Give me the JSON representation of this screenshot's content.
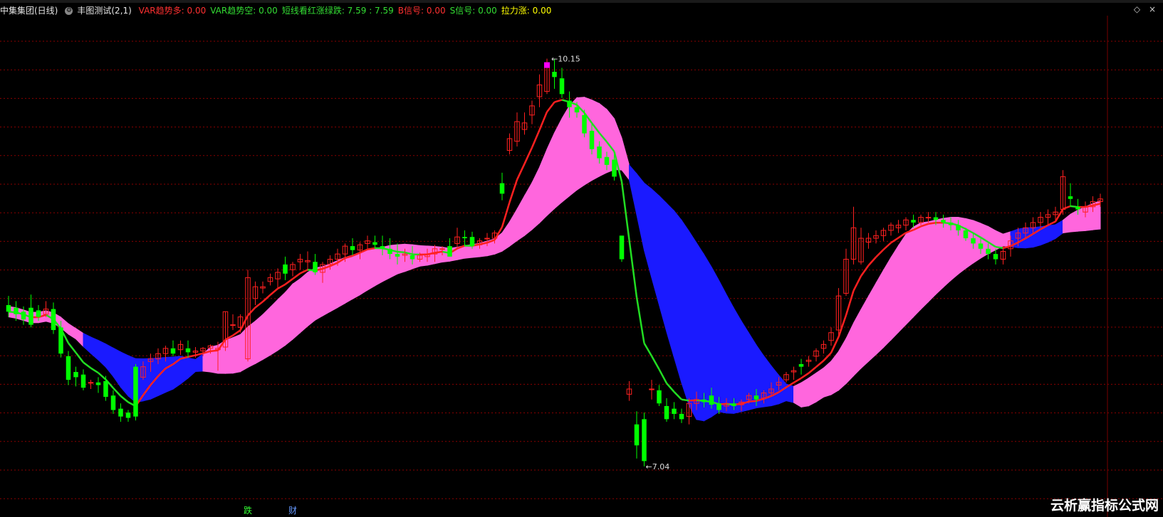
{
  "header": {
    "stock": "中集集团(日线)",
    "indicator": "丰图测试(2,1)",
    "items": [
      {
        "text": "VAR趋势多: 0.00",
        "color": "red"
      },
      {
        "text": "VAR趋势空: 0.00",
        "color": "green"
      },
      {
        "text": "短线看红涨绿跌: 7.59 : 7.59",
        "color": "green"
      },
      {
        "text": "B信号: 0.00",
        "color": "red"
      },
      {
        "text": "S信号: 0.00",
        "color": "green"
      },
      {
        "text": "拉力涨: 0.00",
        "color": "yellow"
      }
    ]
  },
  "window_controls": {
    "diamond": "◇",
    "close": "×"
  },
  "watermark": "云析赢指标公式网",
  "bottom_labels": [
    {
      "text": "跌",
      "index": 32,
      "color": "#33ff33"
    },
    {
      "text": "财",
      "index": 38,
      "color": "#6699ff"
    }
  ],
  "colors": {
    "up": "#ff2020",
    "down": "#00ff00",
    "grid": "#8b0000",
    "trend_up": "#ff2020",
    "trend_down": "#22dd22",
    "band_bull": "#ff66dd",
    "band_bear": "#1a1aff",
    "magenta": "#ff00ff",
    "label_green": "#33ff33",
    "label_red": "#ff3030"
  },
  "chart_data": {
    "type": "candlestick",
    "ylim": [
      6.8,
      10.5
    ],
    "max_label": "10.15",
    "min_label": "7.04",
    "ohlc": [
      [
        8.27,
        8.34,
        8.18,
        8.22
      ],
      [
        8.25,
        8.3,
        8.15,
        8.2
      ],
      [
        8.22,
        8.26,
        8.12,
        8.16
      ],
      [
        8.25,
        8.35,
        8.1,
        8.12
      ],
      [
        8.23,
        8.27,
        8.15,
        8.18
      ],
      [
        8.2,
        8.3,
        8.18,
        8.24
      ],
      [
        8.24,
        8.29,
        8.05,
        8.08
      ],
      [
        8.1,
        8.15,
        7.87,
        7.9
      ],
      [
        7.88,
        7.92,
        7.66,
        7.7
      ],
      [
        7.76,
        7.8,
        7.65,
        7.72
      ],
      [
        7.74,
        7.78,
        7.62,
        7.64
      ],
      [
        7.68,
        7.7,
        7.63,
        7.68
      ],
      [
        7.68,
        7.72,
        7.6,
        7.66
      ],
      [
        7.69,
        7.73,
        7.54,
        7.57
      ],
      [
        7.58,
        7.62,
        7.44,
        7.47
      ],
      [
        7.48,
        7.52,
        7.38,
        7.42
      ],
      [
        7.45,
        7.47,
        7.38,
        7.41
      ],
      [
        7.8,
        7.82,
        7.39,
        7.42
      ],
      [
        7.72,
        7.84,
        7.7,
        7.8
      ],
      [
        7.84,
        7.9,
        7.76,
        7.86
      ],
      [
        7.86,
        7.94,
        7.82,
        7.9
      ],
      [
        7.9,
        7.96,
        7.84,
        7.94
      ],
      [
        7.94,
        8.0,
        7.88,
        7.9
      ],
      [
        7.93,
        8.0,
        7.89,
        7.97
      ],
      [
        7.94,
        8.0,
        7.87,
        7.91
      ],
      [
        7.91,
        7.95,
        7.87,
        7.92
      ],
      [
        7.92,
        7.95,
        7.88,
        7.94
      ],
      [
        7.94,
        7.97,
        7.9,
        7.96
      ],
      [
        7.93,
        7.99,
        7.77,
        7.94
      ],
      [
        7.95,
        8.22,
        7.92,
        8.22
      ],
      [
        8.12,
        8.2,
        8.08,
        8.12
      ],
      [
        8.1,
        8.2,
        8.06,
        8.18
      ],
      [
        7.86,
        8.54,
        7.84,
        8.48
      ],
      [
        8.32,
        8.45,
        8.27,
        8.41
      ],
      [
        8.4,
        8.45,
        8.36,
        8.41
      ],
      [
        8.45,
        8.51,
        8.42,
        8.48
      ],
      [
        8.47,
        8.55,
        8.4,
        8.52
      ],
      [
        8.58,
        8.64,
        8.46,
        8.51
      ],
      [
        8.54,
        8.6,
        8.49,
        8.58
      ],
      [
        8.6,
        8.66,
        8.54,
        8.62
      ],
      [
        8.6,
        8.68,
        8.54,
        8.61
      ],
      [
        8.6,
        8.66,
        8.5,
        8.52
      ],
      [
        8.52,
        8.6,
        8.44,
        8.58
      ],
      [
        8.58,
        8.65,
        8.54,
        8.62
      ],
      [
        8.62,
        8.7,
        8.57,
        8.66
      ],
      [
        8.66,
        8.74,
        8.6,
        8.72
      ],
      [
        8.72,
        8.78,
        8.65,
        8.69
      ],
      [
        8.69,
        8.75,
        8.62,
        8.73
      ],
      [
        8.74,
        8.8,
        8.7,
        8.76
      ],
      [
        8.75,
        8.8,
        8.7,
        8.73
      ],
      [
        8.72,
        8.8,
        8.65,
        8.7
      ],
      [
        8.7,
        8.78,
        8.62,
        8.66
      ],
      [
        8.66,
        8.74,
        8.58,
        8.64
      ],
      [
        8.65,
        8.7,
        8.6,
        8.66
      ],
      [
        8.65,
        8.72,
        8.58,
        8.62
      ],
      [
        8.62,
        8.67,
        8.6,
        8.65
      ],
      [
        8.64,
        8.7,
        8.6,
        8.66
      ],
      [
        8.66,
        8.73,
        8.6,
        8.7
      ],
      [
        8.7,
        8.72,
        8.65,
        8.7
      ],
      [
        8.72,
        8.78,
        8.64,
        8.64
      ],
      [
        8.74,
        8.86,
        8.7,
        8.79
      ],
      [
        8.79,
        8.84,
        8.72,
        8.78
      ],
      [
        8.79,
        8.83,
        8.7,
        8.72
      ],
      [
        8.73,
        8.78,
        8.7,
        8.76
      ],
      [
        8.78,
        8.82,
        8.72,
        8.78
      ],
      [
        8.78,
        8.84,
        8.74,
        8.82
      ],
      [
        9.2,
        9.28,
        9.07,
        9.12
      ],
      [
        9.45,
        9.58,
        9.42,
        9.54
      ],
      [
        9.52,
        9.74,
        9.48,
        9.67
      ],
      [
        9.61,
        9.74,
        9.57,
        9.66
      ],
      [
        9.72,
        9.83,
        9.65,
        9.79
      ],
      [
        9.86,
        10.03,
        9.78,
        9.95
      ],
      [
        9.9,
        10.15,
        9.88,
        10.1
      ],
      [
        10.05,
        10.15,
        9.92,
        10.01
      ],
      [
        10.0,
        10.08,
        9.85,
        9.88
      ],
      [
        9.83,
        9.9,
        9.7,
        9.78
      ],
      [
        9.78,
        9.82,
        9.7,
        9.74
      ],
      [
        9.72,
        9.76,
        9.55,
        9.58
      ],
      [
        9.6,
        9.65,
        9.42,
        9.46
      ],
      [
        9.48,
        9.52,
        9.35,
        9.39
      ],
      [
        9.4,
        9.44,
        9.3,
        9.34
      ],
      [
        9.38,
        9.42,
        9.22,
        9.25
      ],
      [
        8.8,
        8.8,
        8.6,
        8.62
      ],
      [
        7.59,
        7.69,
        7.54,
        7.63
      ],
      [
        7.36,
        7.46,
        7.1,
        7.2
      ],
      [
        7.4,
        7.45,
        7.04,
        7.08
      ],
      [
        7.63,
        7.7,
        7.55,
        7.63
      ],
      [
        7.62,
        7.66,
        7.5,
        7.52
      ],
      [
        7.5,
        7.56,
        7.38,
        7.4
      ],
      [
        7.48,
        7.53,
        7.4,
        7.44
      ],
      [
        7.44,
        7.48,
        7.37,
        7.4
      ],
      [
        7.42,
        7.56,
        7.36,
        7.52
      ],
      [
        7.52,
        7.61,
        7.47,
        7.55
      ],
      [
        7.55,
        7.6,
        7.49,
        7.53
      ],
      [
        7.58,
        7.64,
        7.48,
        7.51
      ],
      [
        7.52,
        7.57,
        7.44,
        7.47
      ],
      [
        7.5,
        7.56,
        7.46,
        7.52
      ],
      [
        7.52,
        7.56,
        7.47,
        7.5
      ],
      [
        7.51,
        7.55,
        7.46,
        7.53
      ],
      [
        7.55,
        7.6,
        7.52,
        7.58
      ],
      [
        7.58,
        7.63,
        7.5,
        7.55
      ],
      [
        7.56,
        7.62,
        7.52,
        7.6
      ],
      [
        7.6,
        7.68,
        7.58,
        7.63
      ],
      [
        7.66,
        7.72,
        7.62,
        7.68
      ],
      [
        7.7,
        7.76,
        7.68,
        7.74
      ],
      [
        7.76,
        7.8,
        7.7,
        7.77
      ],
      [
        7.82,
        7.86,
        7.74,
        7.8
      ],
      [
        7.84,
        7.88,
        7.8,
        7.85
      ],
      [
        7.88,
        7.94,
        7.84,
        7.92
      ],
      [
        7.94,
        8.0,
        7.9,
        7.97
      ],
      [
        8.0,
        8.1,
        7.96,
        8.06
      ],
      [
        8.08,
        8.4,
        8.04,
        8.34
      ],
      [
        8.36,
        8.7,
        8.34,
        8.62
      ],
      [
        8.62,
        9.02,
        8.58,
        8.86
      ],
      [
        8.6,
        8.86,
        8.58,
        8.78
      ],
      [
        8.75,
        8.82,
        8.7,
        8.78
      ],
      [
        8.78,
        8.84,
        8.74,
        8.8
      ],
      [
        8.8,
        8.86,
        8.76,
        8.84
      ],
      [
        8.84,
        8.9,
        8.8,
        8.88
      ],
      [
        8.86,
        8.92,
        8.82,
        8.88
      ],
      [
        8.88,
        8.94,
        8.84,
        8.92
      ],
      [
        8.92,
        8.96,
        8.86,
        8.9
      ],
      [
        8.9,
        8.96,
        8.88,
        8.94
      ],
      [
        8.94,
        8.98,
        8.9,
        8.94
      ],
      [
        8.94,
        8.98,
        8.88,
        8.92
      ],
      [
        8.92,
        8.96,
        8.86,
        8.9
      ],
      [
        8.9,
        8.94,
        8.84,
        8.88
      ],
      [
        8.88,
        8.92,
        8.8,
        8.84
      ],
      [
        8.84,
        8.86,
        8.76,
        8.78
      ],
      [
        8.78,
        8.82,
        8.7,
        8.74
      ],
      [
        8.74,
        8.78,
        8.66,
        8.7
      ],
      [
        8.7,
        8.74,
        8.62,
        8.66
      ],
      [
        8.66,
        8.7,
        8.58,
        8.62
      ],
      [
        8.62,
        8.72,
        8.58,
        8.68
      ],
      [
        8.7,
        8.8,
        8.64,
        8.76
      ],
      [
        8.78,
        8.86,
        8.72,
        8.82
      ],
      [
        8.82,
        8.9,
        8.78,
        8.86
      ],
      [
        8.86,
        8.94,
        8.82,
        8.9
      ],
      [
        8.9,
        8.98,
        8.86,
        8.94
      ],
      [
        8.94,
        9.0,
        8.88,
        8.96
      ],
      [
        8.96,
        9.02,
        8.9,
        8.98
      ],
      [
        9.0,
        9.3,
        8.96,
        9.25
      ],
      [
        9.1,
        9.2,
        9.02,
        9.08
      ],
      [
        9.02,
        9.08,
        8.96,
        9.0
      ],
      [
        8.98,
        9.06,
        8.94,
        9.02
      ],
      [
        9.02,
        9.1,
        8.98,
        9.06
      ],
      [
        9.06,
        9.12,
        9.02,
        9.08
      ]
    ]
  }
}
